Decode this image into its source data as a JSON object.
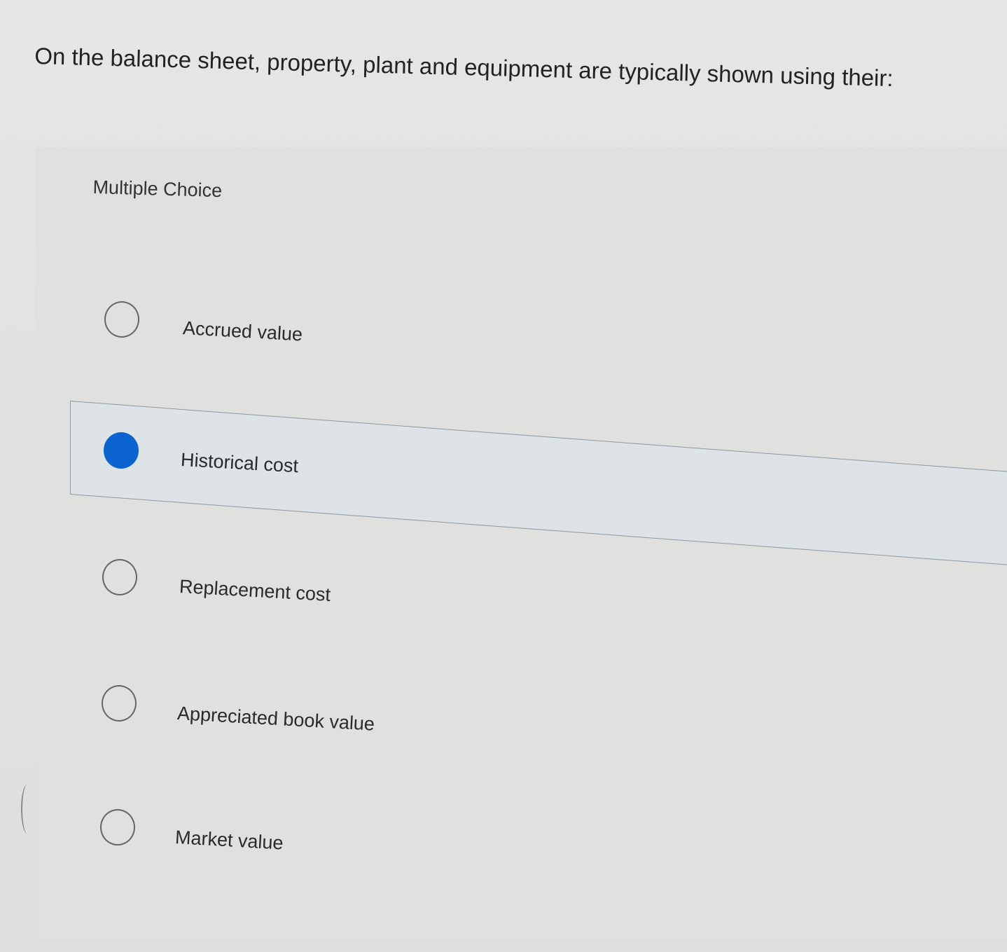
{
  "question": {
    "text": "On the balance sheet, property, plant and equipment are typically shown using their:"
  },
  "section": {
    "label": "Multiple Choice"
  },
  "choices": [
    {
      "label": "Accrued value",
      "selected": false
    },
    {
      "label": "Historical cost",
      "selected": true
    },
    {
      "label": "Replacement cost",
      "selected": false
    },
    {
      "label": "Appreciated book value",
      "selected": false
    },
    {
      "label": "Market value",
      "selected": false
    }
  ],
  "colors": {
    "selected_radio": "#0a63cf",
    "selected_band": "#dde3e6",
    "background": "#e2e2e0"
  }
}
